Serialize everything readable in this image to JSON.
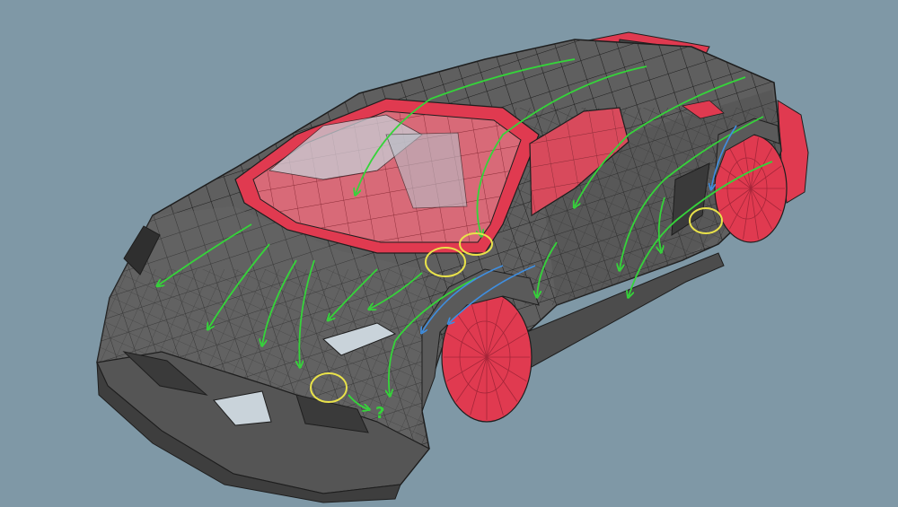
{
  "viewport": {
    "background_color": "#7f98a6",
    "subject": "car-wireframe-model",
    "colors": {
      "body_shell": "#5f5f5f",
      "mesh_lines": "#1e1e1e",
      "highlight_red": "#e03a50",
      "glass_red": "#d84a5c",
      "glass_clear": "#c9d3da",
      "flow_green": "#35d43a",
      "flow_blue": "#3f8ee0",
      "marker_yellow": "#e9e24a"
    },
    "annotations": {
      "question_mark_text": "?",
      "flow_arrows_green": 14,
      "flow_arrows_blue": 3,
      "yellow_circles": 4
    }
  }
}
